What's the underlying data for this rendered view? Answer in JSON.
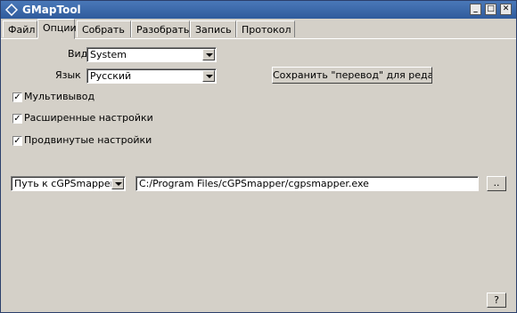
{
  "window": {
    "title": "GMapTool",
    "controls": {
      "minimize": "_",
      "maximize": "□",
      "close": "✕"
    }
  },
  "tabs": [
    {
      "label": "Файл",
      "active": false
    },
    {
      "label": "Опции",
      "active": true
    },
    {
      "label": "Собрать",
      "active": false
    },
    {
      "label": "Разобрать",
      "active": false
    },
    {
      "label": "Запись",
      "active": false
    },
    {
      "label": "Протокол",
      "active": false
    }
  ],
  "options": {
    "view_label": "Вид",
    "view_value": "System",
    "language_label": "Язык",
    "language_value": "Русский",
    "save_translation_button": "Сохранить  \"перевод\" для редактирования",
    "checkboxes": [
      {
        "label": "Мультивывод",
        "checked": true
      },
      {
        "label": "Расширенные настройки",
        "checked": true
      },
      {
        "label": "Продвинутые настройки",
        "checked": true
      }
    ],
    "path_select_value": "Путь к cGPSmapper.exe",
    "path_value": "C:/Program Files/cGPSmapper/cgpsmapper.exe",
    "browse_button": "..",
    "help_button": "?"
  }
}
